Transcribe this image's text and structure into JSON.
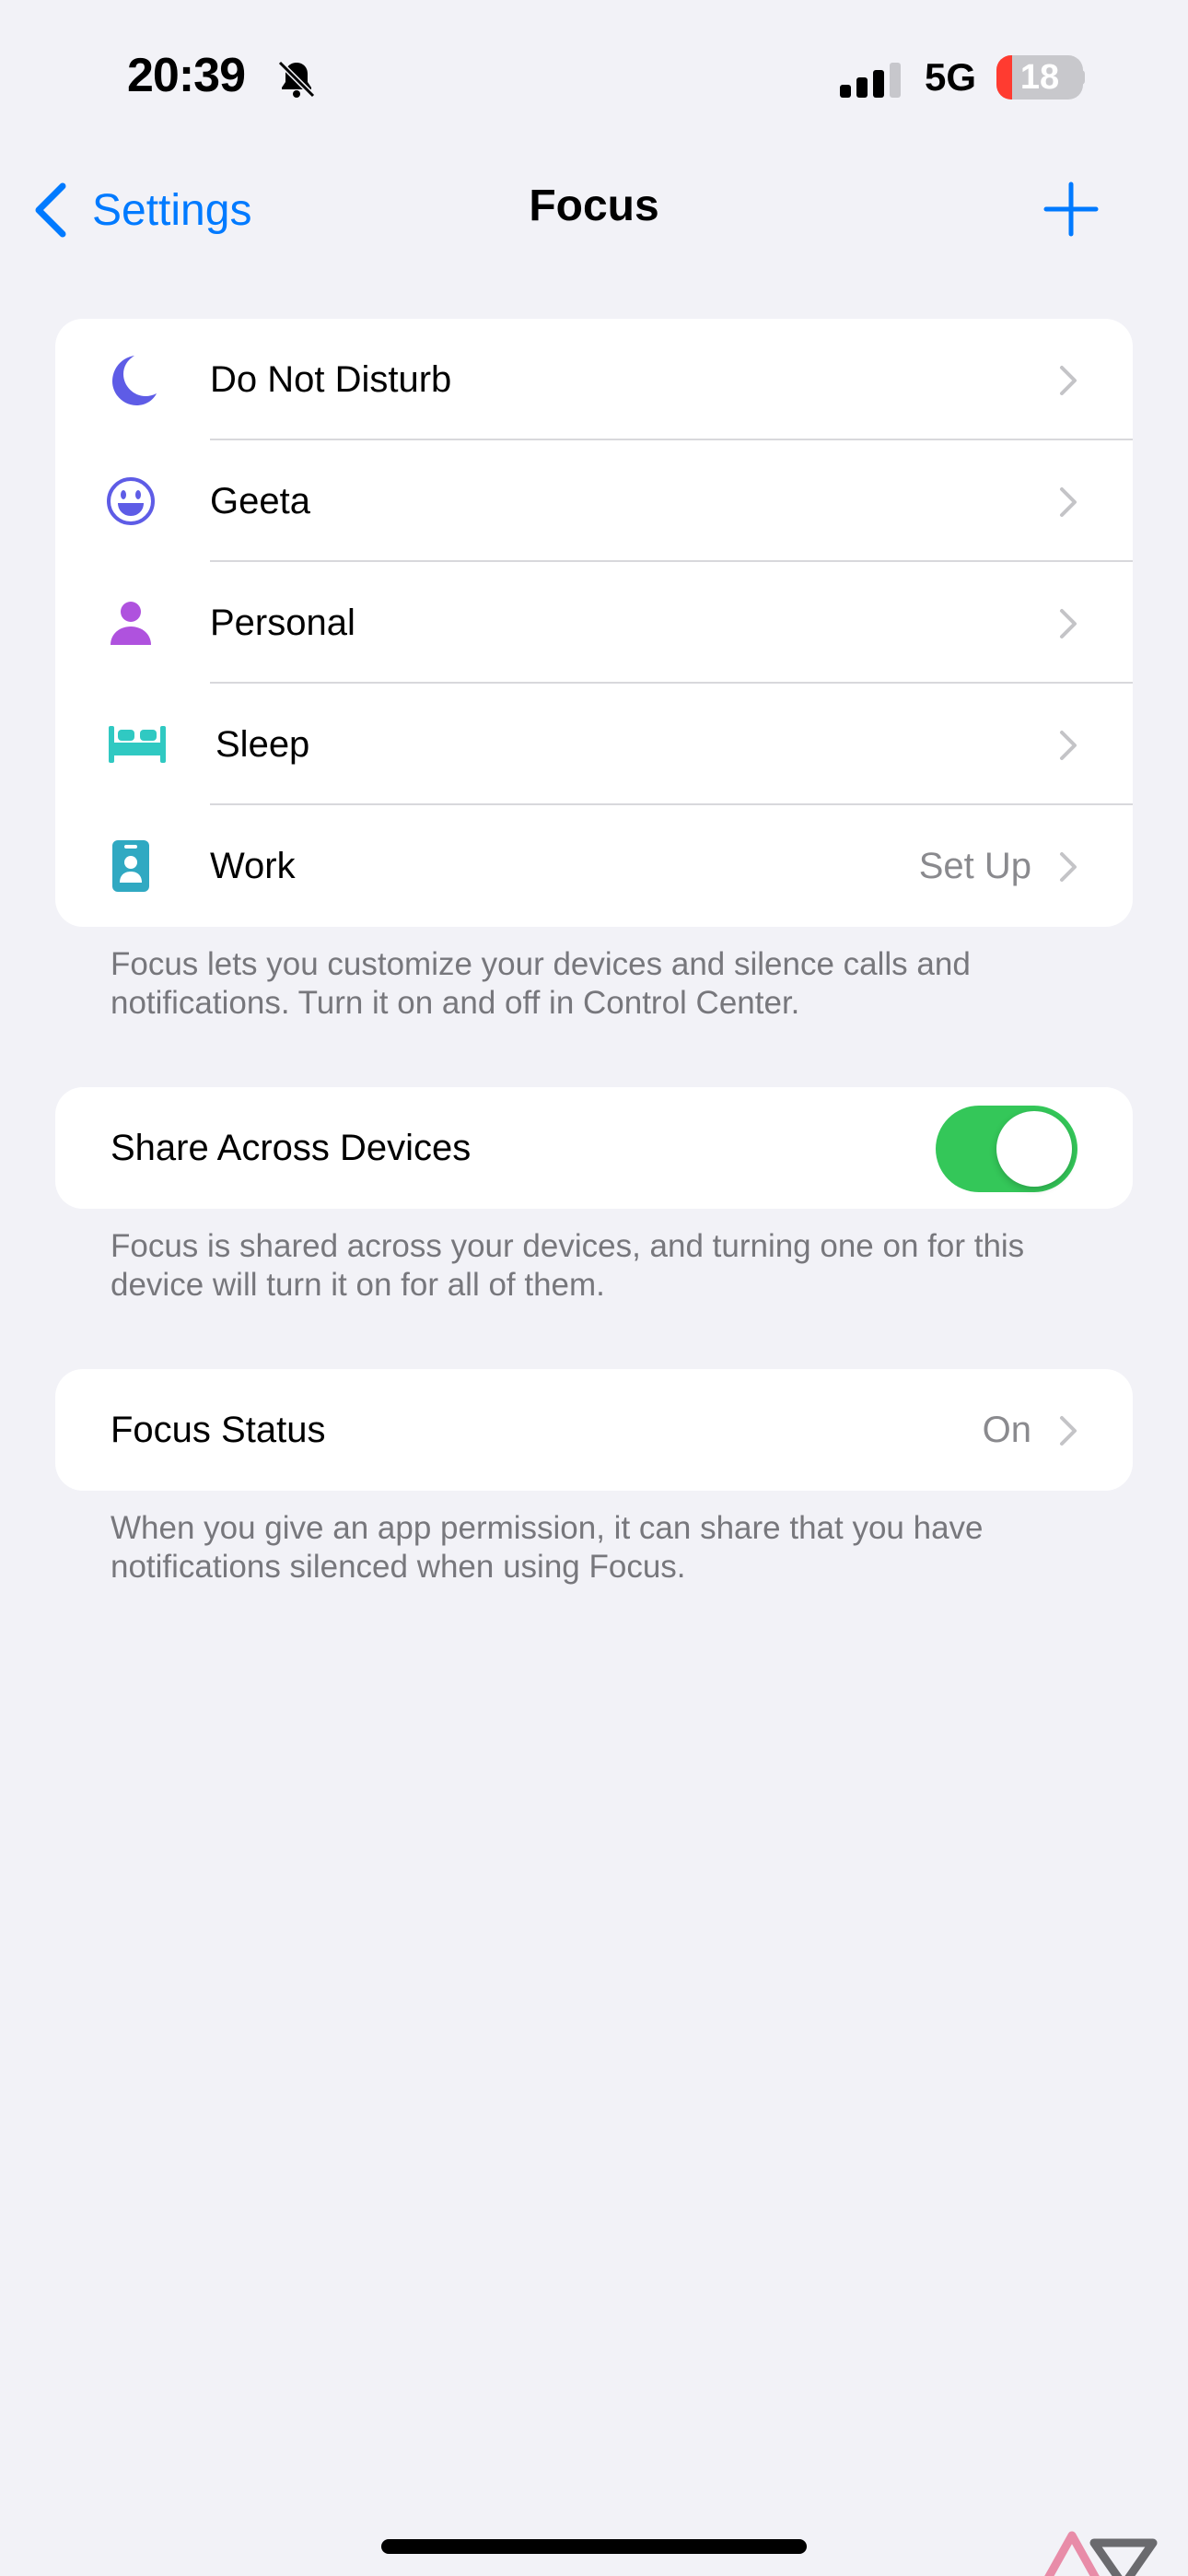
{
  "status_bar": {
    "time": "20:39",
    "network": "5G",
    "battery_level": "18",
    "battery_fraction": 0.18,
    "icons": [
      "bell-slash-icon",
      "signal-icon"
    ]
  },
  "nav": {
    "back_label": "Settings",
    "title": "Focus",
    "add_icon": "plus-icon"
  },
  "focus_modes": [
    {
      "label": "Do Not Disturb",
      "icon": "moon-icon",
      "color": "#5e5ce6",
      "value": ""
    },
    {
      "label": "Geeta",
      "icon": "smiley-icon",
      "color": "#5e5ce6",
      "value": ""
    },
    {
      "label": "Personal",
      "icon": "person-icon",
      "color": "#af52de",
      "value": ""
    },
    {
      "label": "Sleep",
      "icon": "bed-icon",
      "color": "#30c9c2",
      "value": ""
    },
    {
      "label": "Work",
      "icon": "id-badge-icon",
      "color": "#30a9c2",
      "value": "Set Up"
    }
  ],
  "focus_modes_footnote": "Focus lets you customize your devices and silence calls and notifications. Turn it on and off in Control Center.",
  "share_across_devices": {
    "label": "Share Across Devices",
    "enabled": true,
    "footnote": "Focus is shared across your devices, and turning one on for this device will turn it on for all of them."
  },
  "focus_status": {
    "label": "Focus Status",
    "value": "On",
    "footnote": "When you give an app permission, it can share that you have notifications silenced when using Focus."
  },
  "colors": {
    "accent": "#007aff",
    "toggle_on": "#34c759",
    "background": "#f2f2f7",
    "secondary_text": "#8a8a8e"
  }
}
